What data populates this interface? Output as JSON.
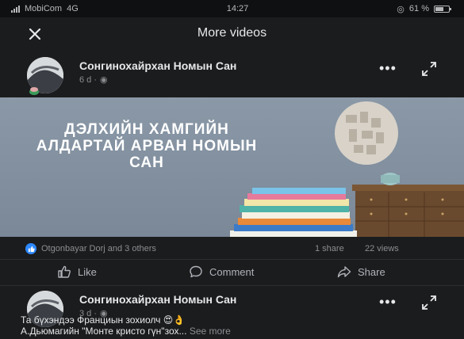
{
  "status_bar": {
    "carrier": "MobiCom",
    "network": "4G",
    "time": "14:27",
    "battery": "61 %",
    "battery_level": 0.61
  },
  "top_bar": {
    "title": "More videos",
    "close_icon": "close-icon"
  },
  "posts": [
    {
      "author": "Сонгинохайрхан Номын Сан",
      "meta": "6 d ·",
      "video_caption": "ДЭЛХИЙН ХАМГИЙН АЛДАРТАЙ АРВАН НОМЫН САН",
      "reactions_text": "Otgonbayar Dorj and 3 others",
      "shares": "1 share",
      "views": "22 views"
    },
    {
      "author": "Сонгинохайрхан Номын Сан",
      "meta": "3 d ·",
      "text_line1": "Та бүхэндээ Франциын зохиолч 😍👌",
      "text_line2": "А.Дьюмагийн \"Монте кристо гүн\"зох...",
      "see_more": "See more"
    }
  ],
  "actions": {
    "like": "Like",
    "comment": "Comment",
    "share": "Share"
  },
  "colors": {
    "background": "#1b1c1e",
    "accent": "#2d88ff",
    "muted": "#8b8d90"
  }
}
